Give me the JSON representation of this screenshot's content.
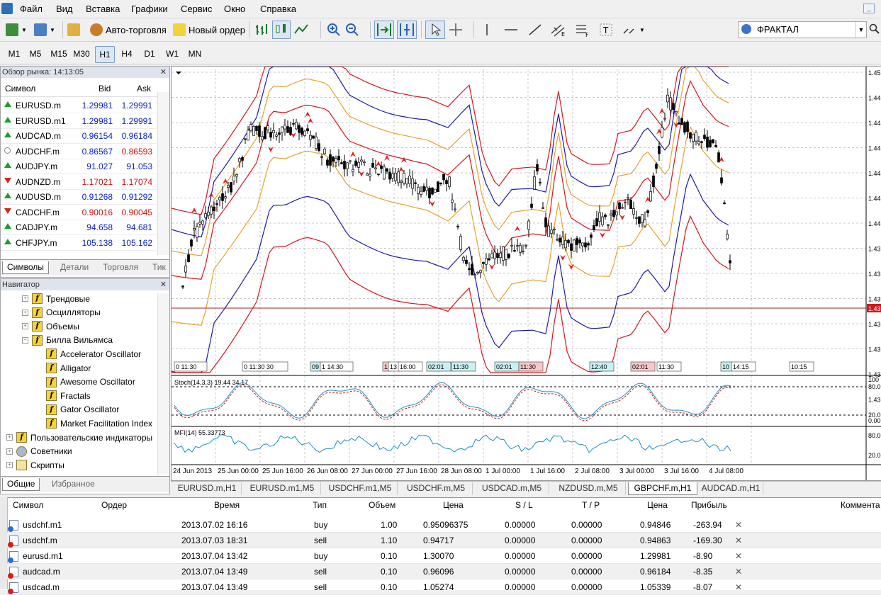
{
  "menu": [
    "Файл",
    "Вид",
    "Вставка",
    "Графики",
    "Сервис",
    "Окно",
    "Справка"
  ],
  "toolbar": {
    "auto_trading": "Авто-торговля",
    "new_order": "Новый ордер",
    "search_value": "ФРАКТАЛ"
  },
  "timeframes": [
    "M1",
    "M5",
    "M15",
    "M30",
    "H1",
    "H4",
    "D1",
    "W1",
    "MN"
  ],
  "active_timeframe": "H1",
  "market_watch": {
    "title": "Обзор рынка: 14:13:05",
    "columns": [
      "Символ",
      "Bid",
      "Ask"
    ],
    "rows": [
      {
        "symbol": "EURUSD.m",
        "bid": "1.29981",
        "ask": "1.29991",
        "dir": "up",
        "color": "blue"
      },
      {
        "symbol": "EURUSD.m1",
        "bid": "1.29981",
        "ask": "1.29991",
        "dir": "up",
        "color": "blue"
      },
      {
        "symbol": "AUDCAD.m",
        "bid": "0.96154",
        "ask": "0.96184",
        "dir": "up",
        "color": "blue"
      },
      {
        "symbol": "AUDCHF.m",
        "bid": "0.86567",
        "ask": "0.86593",
        "dir": "flat",
        "color": "mixed"
      },
      {
        "symbol": "AUDJPY.m",
        "bid": "91.027",
        "ask": "91.053",
        "dir": "up",
        "color": "blue"
      },
      {
        "symbol": "AUDNZD.m",
        "bid": "1.17021",
        "ask": "1.17074",
        "dir": "down",
        "color": "red"
      },
      {
        "symbol": "AUDUSD.m",
        "bid": "0.91268",
        "ask": "0.91292",
        "dir": "up",
        "color": "blue"
      },
      {
        "symbol": "CADCHF.m",
        "bid": "0.90016",
        "ask": "0.90045",
        "dir": "down",
        "color": "red"
      },
      {
        "symbol": "CADJPY.m",
        "bid": "94.658",
        "ask": "94.681",
        "dir": "up",
        "color": "blue"
      },
      {
        "symbol": "CHFJPY.m",
        "bid": "105.138",
        "ask": "105.162",
        "dir": "up",
        "color": "blue"
      }
    ],
    "tabs": [
      "Символы",
      "Детали",
      "Торговля",
      "Тик"
    ]
  },
  "navigator": {
    "title": "Навигатор",
    "items": [
      {
        "label": "Трендовые",
        "level": 1
      },
      {
        "label": "Осцилляторы",
        "level": 1
      },
      {
        "label": "Объемы",
        "level": 1
      },
      {
        "label": "Билла Вильямса",
        "level": 1
      },
      {
        "label": "Accelerator Oscillator",
        "level": 2
      },
      {
        "label": "Alligator",
        "level": 2
      },
      {
        "label": "Awesome Oscillator",
        "level": 2
      },
      {
        "label": "Fractals",
        "level": 2
      },
      {
        "label": "Gator Oscillator",
        "level": 2
      },
      {
        "label": "Market Facilitation Index",
        "level": 2
      },
      {
        "label": "Пользовательские индикаторы",
        "level": 0
      },
      {
        "label": "Советники",
        "level": 0
      },
      {
        "label": "Скрипты",
        "level": 0
      }
    ],
    "tabs": [
      "Общие",
      "Избранное"
    ]
  },
  "chart": {
    "price_labels": [
      "1.45",
      "1.44",
      "1.44",
      "1.44",
      "1.44",
      "1.44",
      "1.44",
      "1.43",
      "1.43",
      "1.43",
      "1.43",
      "1.43",
      "1.43",
      "1.43"
    ],
    "current_price": "1.43",
    "time_markers": [
      {
        "text": "0 11:30",
        "color": "#ffffff"
      },
      {
        "text": "0 11:30 30",
        "color": "#ffffff"
      },
      {
        "text": "09",
        "color": "#c9f1f1"
      },
      {
        "text": "1 14:30",
        "color": "#ffffff"
      },
      {
        "text": "1",
        "color": "#f6caca"
      },
      {
        "text": "13",
        "color": "#ffffff"
      },
      {
        "text": "16:00",
        "color": "#ffffff"
      },
      {
        "text": "02:01",
        "color": "#c9f1f1"
      },
      {
        "text": "11:30",
        "color": "#c9f1f1"
      },
      {
        "text": "02:01",
        "color": "#c9f1f1"
      },
      {
        "text": "11:30",
        "color": "#f6caca"
      },
      {
        "text": "12:40",
        "color": "#c9f1f1"
      },
      {
        "text": "02:01",
        "color": "#f6caca"
      },
      {
        "text": "11:30",
        "color": "#ffffff"
      },
      {
        "text": "10",
        "color": "#c9f1f1"
      },
      {
        "text": "14:15",
        "color": "#ffffff"
      },
      {
        "text": "10:15",
        "color": "#ffffff"
      }
    ],
    "stoch_label": "Stoch(14,3,3) 19.44 34.17",
    "stoch_scale": [
      "100",
      "80.0",
      "20.0",
      "0.00"
    ],
    "mfi_label": "MFI(14) 55.33773",
    "mfi_scale": [
      "80.0",
      "20.0"
    ],
    "x_labels": [
      "24 Jun 2013",
      "25 Jun 00:00",
      "25 Jun 16:00",
      "26 Jun 08:00",
      "27 Jun 00:00",
      "27 Jun 16:00",
      "28 Jun 08:00",
      "1 Jul 00:00",
      "1 Jul 16:00",
      "2 Jul 08:00",
      "3 Jul 00:00",
      "3 Jul 16:00",
      "4 Jul 08:00"
    ],
    "colors": {
      "bb_outer": "#d8141c",
      "bb_mid": "#e8a12e",
      "bb_blue": "#1c1ca8",
      "stoch": "#1e8fc0",
      "fractal": "#e02020"
    }
  },
  "chart_tabs": [
    "EURUSD.m,H1",
    "EURUSD.m1,M5",
    "USDCHF.m1,M5",
    "USDCHF.m,M5",
    "USDCAD.m,M5",
    "NZDUSD.m,M5",
    "GBPCHF.m,H1",
    "AUDCAD.m,H1"
  ],
  "active_chart_tab": "GBPCHF.m,H1",
  "terminal": {
    "columns": [
      "Символ",
      "Ордер",
      "Время",
      "Тип",
      "Объем",
      "Цена",
      "S / L",
      "T / P",
      "Цена",
      "Прибыль",
      "Коммента"
    ],
    "rows": [
      {
        "symbol": "usdchf.m1",
        "time": "2013.07.02 16:16",
        "type": "buy",
        "volume": "1.00",
        "price": "0.95096375",
        "sl": "0.00000",
        "tp": "0.00000",
        "cur": "0.94846",
        "profit": "-263.94"
      },
      {
        "symbol": "usdchf.m",
        "time": "2013.07.03 18:31",
        "type": "sell",
        "volume": "1.10",
        "price": "0.94717",
        "sl": "0.00000",
        "tp": "0.00000",
        "cur": "0.94863",
        "profit": "-169.30"
      },
      {
        "symbol": "eurusd.m1",
        "time": "2013.07.04 13:42",
        "type": "buy",
        "volume": "0.10",
        "price": "1.30070",
        "sl": "0.00000",
        "tp": "0.00000",
        "cur": "1.29981",
        "profit": "-8.90"
      },
      {
        "symbol": "audcad.m",
        "time": "2013.07.04 13:49",
        "type": "sell",
        "volume": "0.10",
        "price": "0.96096",
        "sl": "0.00000",
        "tp": "0.00000",
        "cur": "0.96184",
        "profit": "-8.35"
      },
      {
        "symbol": "usdcad.m",
        "time": "2013.07.04 13:49",
        "type": "sell",
        "volume": "0.10",
        "price": "1.05274",
        "sl": "0.00000",
        "tp": "0.00000",
        "cur": "1.05339",
        "profit": "-8.07"
      }
    ]
  }
}
